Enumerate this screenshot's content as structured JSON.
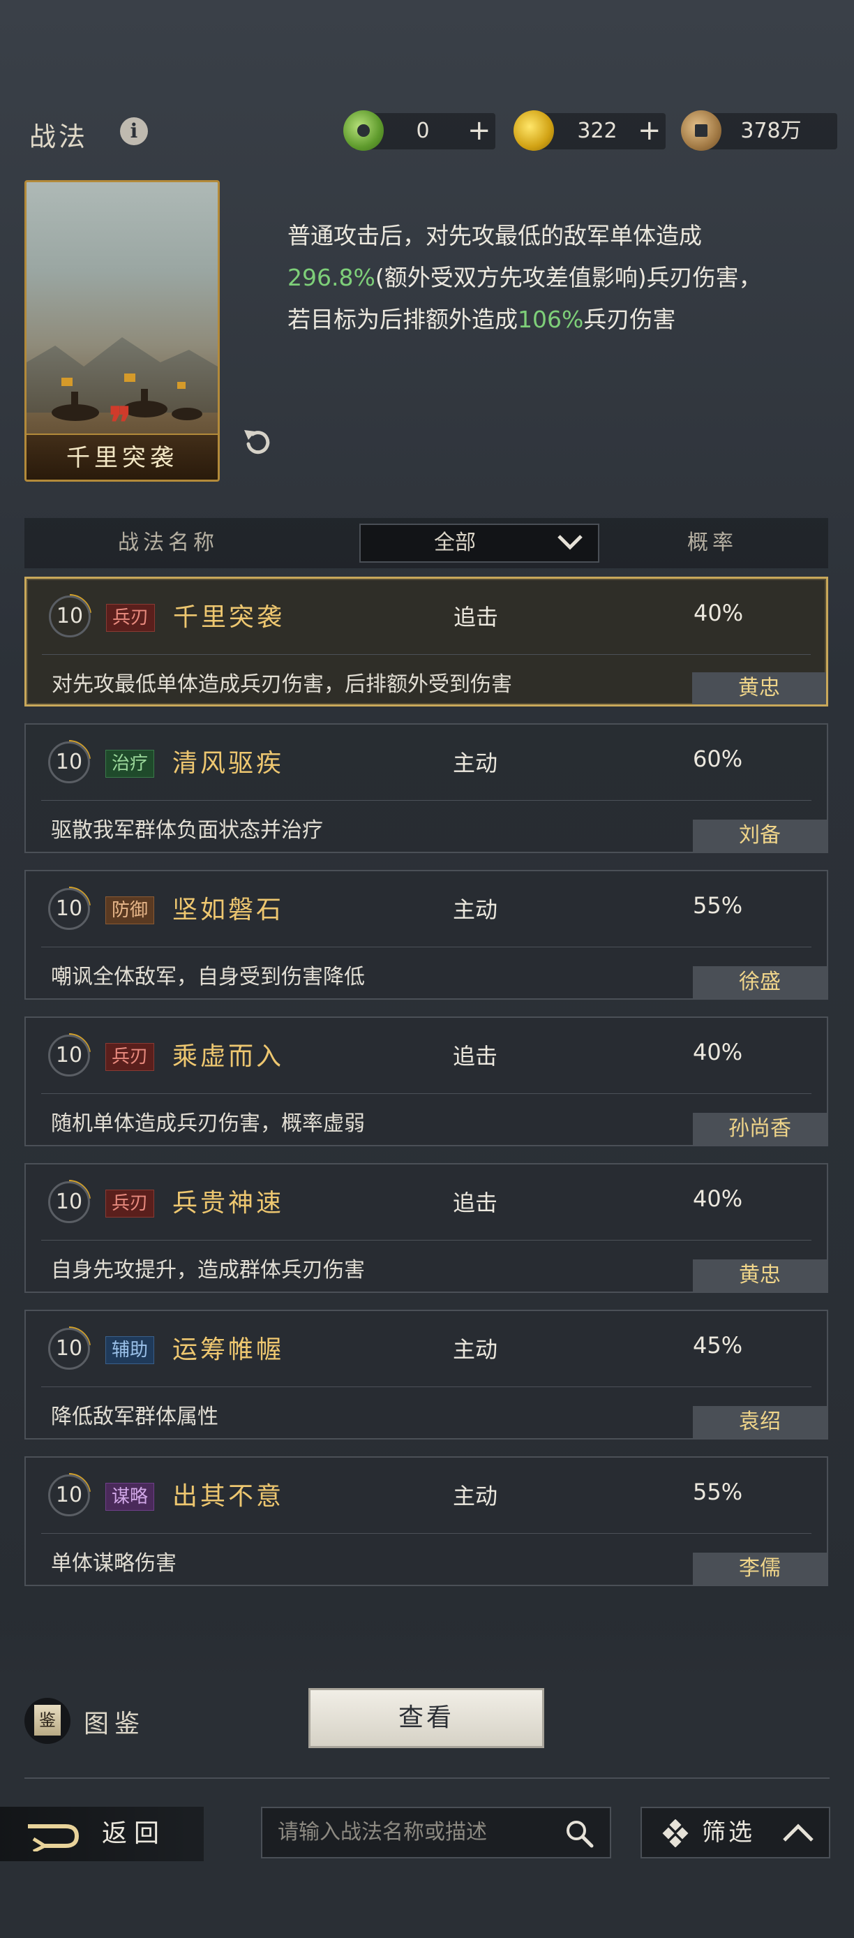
{
  "header": {
    "title": "战法",
    "info_icon": "info-icon",
    "currencies": [
      {
        "icon": "jade-coin-icon",
        "value": "0",
        "has_add": true
      },
      {
        "icon": "gold-coin-icon",
        "value": "322",
        "has_add": true
      },
      {
        "icon": "copper-coin-icon",
        "value": "378万",
        "has_add": false
      }
    ]
  },
  "selected_skill": {
    "card_name": "千里突袭",
    "description_parts": [
      {
        "text": "普通攻击后，对先攻最低的敌军单体造成",
        "highlight": false
      },
      {
        "text": "296.8%",
        "highlight": true
      },
      {
        "text": "(额外受双方先攻差值影响)兵刃伤害，若目标为后排额外造成",
        "highlight": false
      },
      {
        "text": "106%",
        "highlight": true
      },
      {
        "text": "兵刃伤害",
        "highlight": false
      }
    ]
  },
  "list_header": {
    "name_col": "战法名称",
    "filter": "全部",
    "rate_col": "概率"
  },
  "skills": [
    {
      "level": "10",
      "tag": "兵刃",
      "tag_color": "red",
      "name": "千里突袭",
      "type": "追击",
      "rate": "40%",
      "effect": "对先攻最低单体造成兵刃伤害，后排额外受到伤害",
      "hero": "黄忠",
      "selected": true
    },
    {
      "level": "10",
      "tag": "治疗",
      "tag_color": "green",
      "name": "清风驱疾",
      "type": "主动",
      "rate": "60%",
      "effect": "驱散我军群体负面状态并治疗",
      "hero": "刘备",
      "selected": false
    },
    {
      "level": "10",
      "tag": "防御",
      "tag_color": "brown",
      "name": "坚如磐石",
      "type": "主动",
      "rate": "55%",
      "effect": "嘲讽全体敌军，自身受到伤害降低",
      "hero": "徐盛",
      "selected": false
    },
    {
      "level": "10",
      "tag": "兵刃",
      "tag_color": "red",
      "name": "乘虚而入",
      "type": "追击",
      "rate": "40%",
      "effect": "随机单体造成兵刃伤害，概率虚弱",
      "hero": "孙尚香",
      "selected": false
    },
    {
      "level": "10",
      "tag": "兵刃",
      "tag_color": "red",
      "name": "兵贵神速",
      "type": "追击",
      "rate": "40%",
      "effect": "自身先攻提升，造成群体兵刃伤害",
      "hero": "黄忠",
      "selected": false
    },
    {
      "level": "10",
      "tag": "辅助",
      "tag_color": "blue",
      "name": "运筹帷幄",
      "type": "主动",
      "rate": "45%",
      "effect": "降低敌军群体属性",
      "hero": "袁绍",
      "selected": false
    },
    {
      "level": "10",
      "tag": "谋略",
      "tag_color": "purple",
      "name": "出其不意",
      "type": "主动",
      "rate": "55%",
      "effect": "单体谋略伤害",
      "hero": "李儒",
      "selected": false
    }
  ],
  "bottom": {
    "atlas_icon_char": "鉴",
    "atlas_label": "图鉴",
    "view_button": "查看",
    "back_label": "返回",
    "search_placeholder": "请输入战法名称或描述",
    "filter_label": "筛选"
  }
}
